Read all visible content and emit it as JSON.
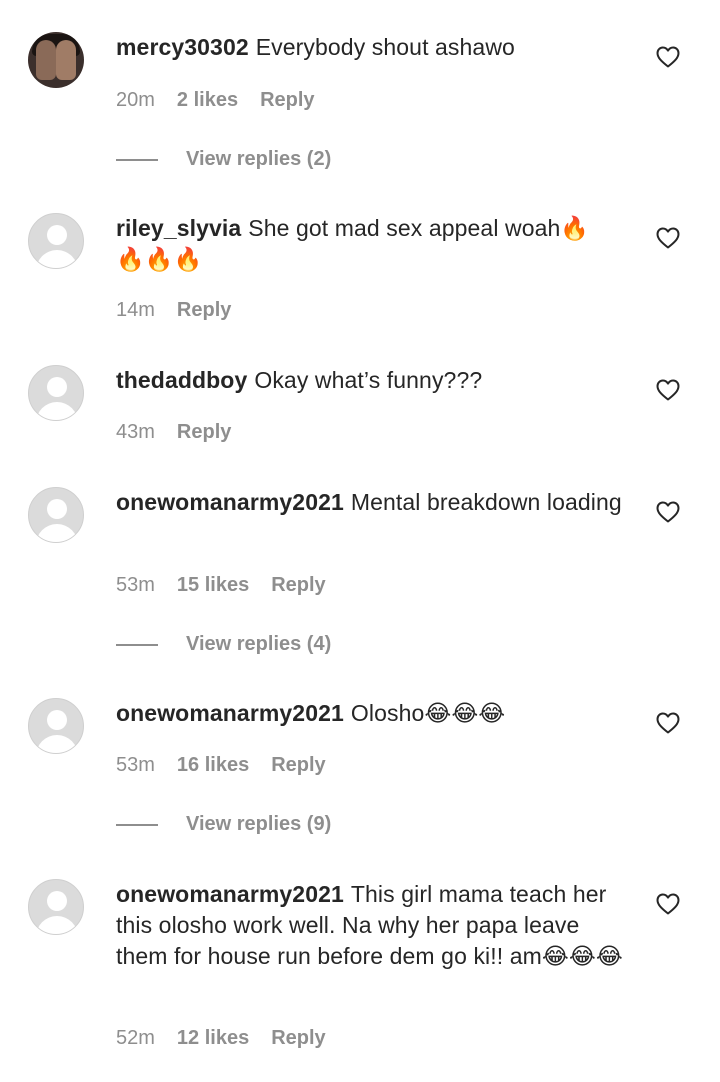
{
  "comments": [
    {
      "username": "mercy30302",
      "text": "Everybody shout ashawo",
      "time": "20m",
      "likes": "2 likes",
      "reply": "Reply",
      "view_replies": "View replies (2)"
    },
    {
      "username": "riley_slyvia",
      "text": "She got mad sex appeal woah🔥🔥🔥🔥",
      "time": "14m",
      "reply": "Reply"
    },
    {
      "username": "thedaddboy",
      "text": "Okay what’s funny???",
      "time": "43m",
      "reply": "Reply"
    },
    {
      "username": "onewomanarmy2021",
      "text": "Mental breakdown loading",
      "time": "53m",
      "likes": "15 likes",
      "reply": "Reply",
      "view_replies": "View replies (4)"
    },
    {
      "username": "onewomanarmy2021",
      "text": "Olosho😂😂😂",
      "time": "53m",
      "likes": "16 likes",
      "reply": "Reply",
      "view_replies": "View replies (9)"
    },
    {
      "username": "onewomanarmy2021",
      "text": "This girl mama teach her this olosho work well. Na why her papa leave them for house run before dem go ki!! am😂😂😂",
      "time": "52m",
      "likes": "12 likes",
      "reply": "Reply"
    }
  ],
  "icons": {
    "like": "heart-outline-icon",
    "default_avatar": "default-avatar-icon"
  },
  "colors": {
    "text": "#262626",
    "secondary": "#8e8e8e",
    "avatar_placeholder": "#dbdbdb"
  }
}
